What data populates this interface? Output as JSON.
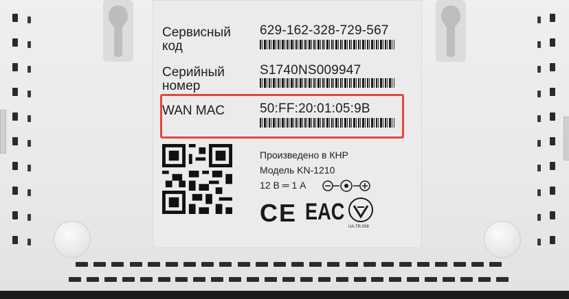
{
  "label": {
    "service_code_label": "Сервисный\nкод",
    "service_code_label_l1": "Сервисный",
    "service_code_label_l2": "код",
    "service_code": "629-162-328-729-567",
    "serial_label_l1": "Серийный",
    "serial_label_l2": "номер",
    "serial": "S1740NS009947",
    "wan_mac_label": "WAN MAC",
    "wan_mac": "50:FF:20:01:05:9B",
    "made_in": "Произведено в КНР",
    "model": "Модель KN-1210",
    "power": "12 В ═ 1 А",
    "ce_mark": "CE",
    "eac_mark": "EAC",
    "ukr_mark_caption": "UA.TR.008"
  },
  "colors": {
    "highlight_border": "#e0473f",
    "device_body": "#ebebeb",
    "text": "#1d1d1d"
  }
}
